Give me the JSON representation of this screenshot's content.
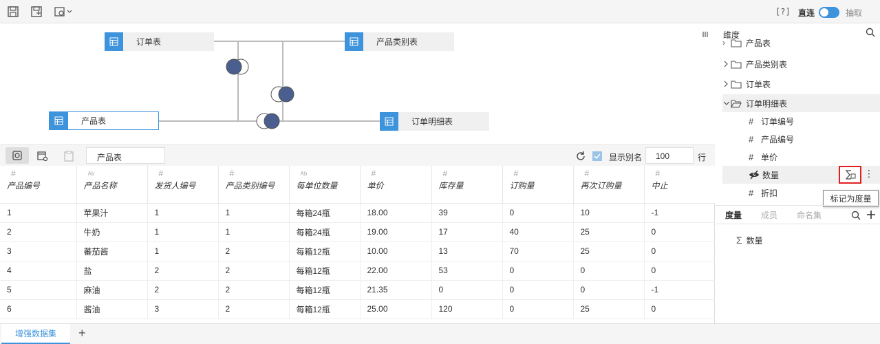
{
  "toolbar": {
    "help": "[?]",
    "mode_direct": "直连",
    "mode_extract": "抽取"
  },
  "model": {
    "tables": [
      "订单表",
      "产品类别表",
      "产品表",
      "订单明细表"
    ]
  },
  "data_toolbar": {
    "table_name": "产品表",
    "show_alias": "显示别名",
    "row_count": "100",
    "row_unit": "行"
  },
  "grid": {
    "columns": [
      {
        "type": "#",
        "name": "产品编号"
      },
      {
        "type": "Ab",
        "name": "产品名称"
      },
      {
        "type": "#",
        "name": "发货人编号"
      },
      {
        "type": "#",
        "name": "产品类别编号"
      },
      {
        "type": "Ab",
        "name": "每单位数量"
      },
      {
        "type": "#",
        "name": "单价"
      },
      {
        "type": "#",
        "name": "库存量"
      },
      {
        "type": "#",
        "name": "订购量"
      },
      {
        "type": "#",
        "name": "再次订购量"
      },
      {
        "type": "#",
        "name": "中止"
      }
    ],
    "rows": [
      [
        "1",
        "苹果汁",
        "1",
        "1",
        "每箱24瓶",
        "18.00",
        "39",
        "0",
        "10",
        "-1"
      ],
      [
        "2",
        "牛奶",
        "1",
        "1",
        "每箱24瓶",
        "19.00",
        "17",
        "40",
        "25",
        "0"
      ],
      [
        "3",
        "蕃茄酱",
        "1",
        "2",
        "每箱12瓶",
        "10.00",
        "13",
        "70",
        "25",
        "0"
      ],
      [
        "4",
        "盐",
        "2",
        "2",
        "每箱12瓶",
        "22.00",
        "53",
        "0",
        "0",
        "0"
      ],
      [
        "5",
        "麻油",
        "2",
        "2",
        "每箱12瓶",
        "21.35",
        "0",
        "0",
        "0",
        "-1"
      ],
      [
        "6",
        "酱油",
        "3",
        "2",
        "每箱12瓶",
        "25.00",
        "120",
        "0",
        "25",
        "0"
      ]
    ]
  },
  "tree": {
    "header": "维度",
    "partial_item": "产品表",
    "folders": [
      "产品类别表",
      "订单表",
      "订单明细表"
    ],
    "fields": [
      "订单编号",
      "产品编号",
      "单价",
      "数量",
      "折扣"
    ],
    "tooltip": "标记为度量"
  },
  "measure_tabs": [
    "度量",
    "成员",
    "命名集"
  ],
  "measures": [
    "数量"
  ],
  "bottom": {
    "tab": "增强数据集",
    "add": "+"
  }
}
